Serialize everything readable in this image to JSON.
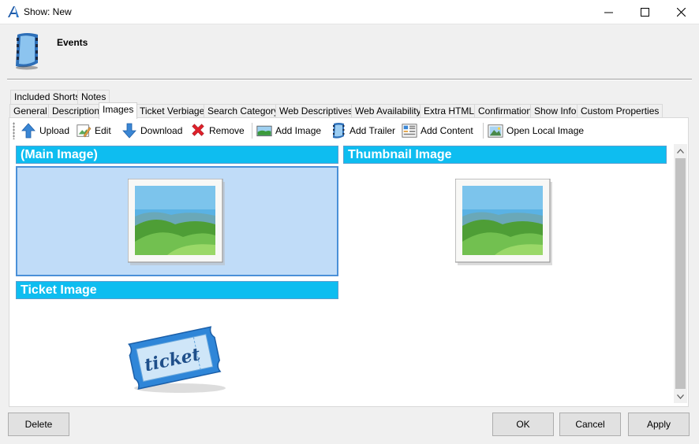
{
  "window": {
    "title": "Show: New"
  },
  "header": {
    "heading": "Events"
  },
  "tabs_row1": [
    {
      "label": "Included Shorts"
    },
    {
      "label": "Notes"
    }
  ],
  "tabs_row2": [
    {
      "label": "General"
    },
    {
      "label": "Description"
    },
    {
      "label": "Images"
    },
    {
      "label": "Ticket Verbiage"
    },
    {
      "label": "Search Category"
    },
    {
      "label": "Web Descriptives"
    },
    {
      "label": "Web Availability"
    },
    {
      "label": "Extra HTML"
    },
    {
      "label": "Confirmation"
    },
    {
      "label": "Show Info"
    },
    {
      "label": "Custom Properties"
    }
  ],
  "active_tab": "Images",
  "toolbar": {
    "upload": "Upload",
    "edit": "Edit",
    "download": "Download",
    "remove": "Remove",
    "add_image": "Add Image",
    "add_trailer": "Add Trailer",
    "add_content": "Add Content",
    "open_local_image": "Open Local Image"
  },
  "images": {
    "main": "(Main Image)",
    "thumbnail": "Thumbnail Image",
    "ticket": "Ticket Image",
    "ticket_art_text": "ticket"
  },
  "buttons": {
    "delete": "Delete",
    "ok": "OK",
    "cancel": "Cancel",
    "apply": "Apply"
  },
  "colors": {
    "section_bar": "#0ebdf0",
    "selection": "#c0dcf8",
    "selection_border": "#4a90d8"
  }
}
